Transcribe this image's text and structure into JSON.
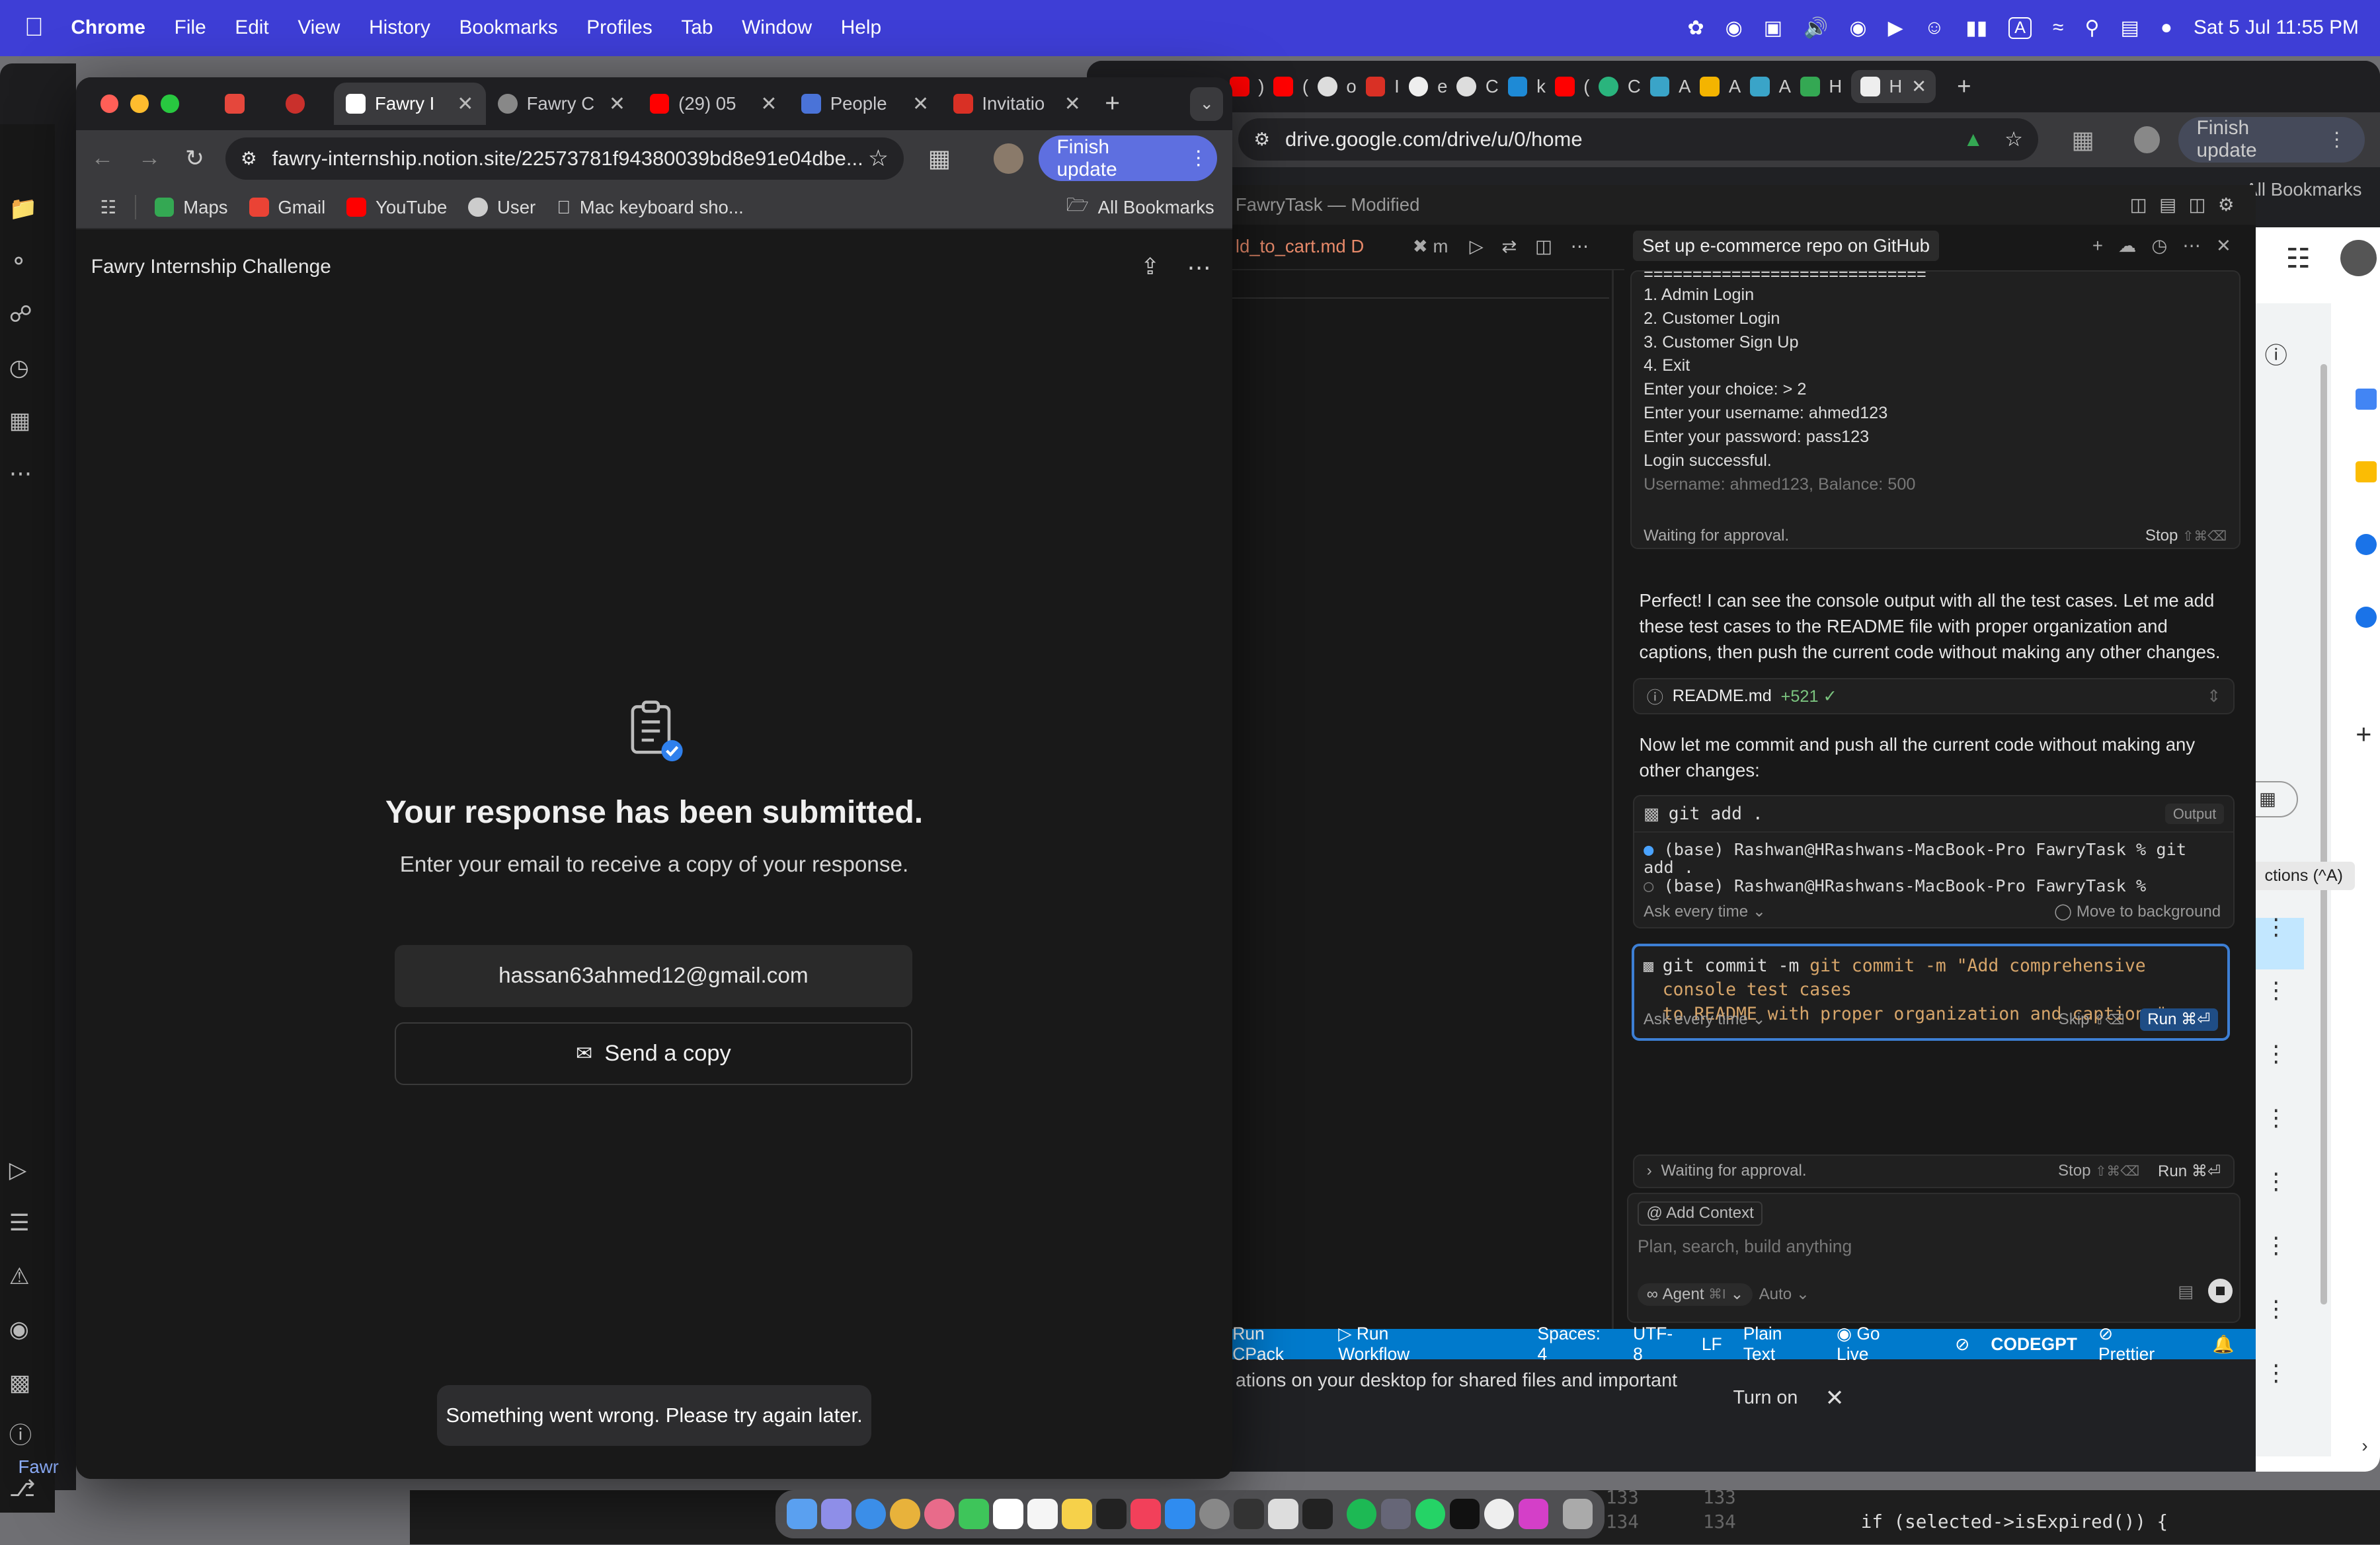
{
  "menubar": {
    "app": "Chrome",
    "items": [
      "File",
      "Edit",
      "View",
      "History",
      "Bookmarks",
      "Profiles",
      "Tab",
      "Window",
      "Help"
    ],
    "clock": "Sat 5 Jul  11:55 PM"
  },
  "front_browser": {
    "tabs": [
      {
        "label": "",
        "color": "#e5473c"
      },
      {
        "label": "",
        "color": "#c9302c"
      },
      {
        "label": "Fawry I",
        "color": "#ffffff",
        "active": true
      },
      {
        "label": "Fawry C",
        "color": "#888888"
      },
      {
        "label": "(29) 05",
        "color": "#ff0000"
      },
      {
        "label": "People",
        "color": "#4a73d8"
      },
      {
        "label": "Invitatio",
        "color": "#d93025"
      }
    ],
    "url": "fawry-internship.notion.site/22573781f94380039bd8e91e04dbe...",
    "finish_update": "Finish update",
    "bookmarks": [
      "Maps",
      "Gmail",
      "YouTube",
      "User",
      "Mac keyboard sho..."
    ],
    "all_bookmarks": "All Bookmarks"
  },
  "notion": {
    "page_title": "Fawry Internship Challenge",
    "heading": "Your response has been submitted.",
    "subtitle": "Enter your email to receive a copy of your response.",
    "email": "hassan63ahmed12@gmail.com",
    "send_copy": "Send a copy",
    "toast": "Something went wrong. Please try again later."
  },
  "back_browser": {
    "url": "drive.google.com/drive/u/0/home",
    "finish_update": "Finish update",
    "all_bookmarks": "All Bookmarks",
    "tab_labels": [
      ")",
      "(",
      "o",
      "I",
      "e",
      "C",
      "k",
      "(",
      "C",
      "A",
      "A",
      "A",
      "H",
      "H"
    ],
    "drive_tooltip": "ctions (^A)"
  },
  "vscode": {
    "title": "FawryTask — Modified",
    "tab_file": "ld_to_cart.md",
    "tab_badge": "D",
    "tab_m": "m",
    "chat_title": "Set up e-commerce repo on GitHub",
    "console_lines": [
      "=============================",
      "1. Admin Login",
      "2. Customer Login",
      "3. Customer Sign Up",
      "4. Exit",
      "Enter your choice: > 2",
      "Enter your username: ahmed123",
      "Enter your password: pass123",
      "Login successful.",
      "Username: ahmed123, Balance: 500"
    ],
    "waiting1": "Waiting for approval.",
    "stop1": "Stop",
    "stop1_key": "⇧⌘⌫",
    "msg1": "Perfect! I can see the console output with all the test cases. Let me add these test cases to the README file with proper organization and captions, then push the current code without making any other changes.",
    "readme_file": "README.md",
    "readme_diff": "+521 ✓",
    "msg2": "Now let me commit and push all the current code without making any other changes:",
    "cmd1": "git add .",
    "output_label": "Output",
    "term_lines": [
      "(base) Rashwan@HRashwans-MacBook-Pro FawryTask % git add .",
      "(base) Rashwan@HRashwans-MacBook-Pro FawryTask %"
    ],
    "ask_every_time": "Ask every time",
    "move_bg": "Move to background",
    "cmd2_line1": "git commit -m \"Add comprehensive console test cases",
    "cmd2_line2": "to README with proper organization and captions\"",
    "skip": "Skip",
    "skip_key": "⇧⌫",
    "run": "Run",
    "run_key": "⌘⏎",
    "waiting2": "Waiting for approval.",
    "stop2": "Stop",
    "stop2_key": "⇧⌘⌫",
    "run2": "Run ⌘⏎",
    "add_context": "Add Context",
    "input_placeholder": "Plan, search, build anything",
    "agent": "Agent",
    "agent_key": "⌘I",
    "auto": "Auto",
    "status_items": [
      "Run CPack",
      "Run Workflow",
      "Spaces: 4",
      "UTF-8",
      "LF",
      "Plain Text",
      "Go Live",
      "CODEGPT",
      "Prettier"
    ]
  },
  "drive_notice": {
    "text": "ations on your desktop for shared files and important",
    "turn_on": "Turn on"
  },
  "sidebar_bottom": "Fawr",
  "code_peek": {
    "line_a": "133",
    "line_b": "134",
    "code": "if (selected->isExpired()) {"
  }
}
